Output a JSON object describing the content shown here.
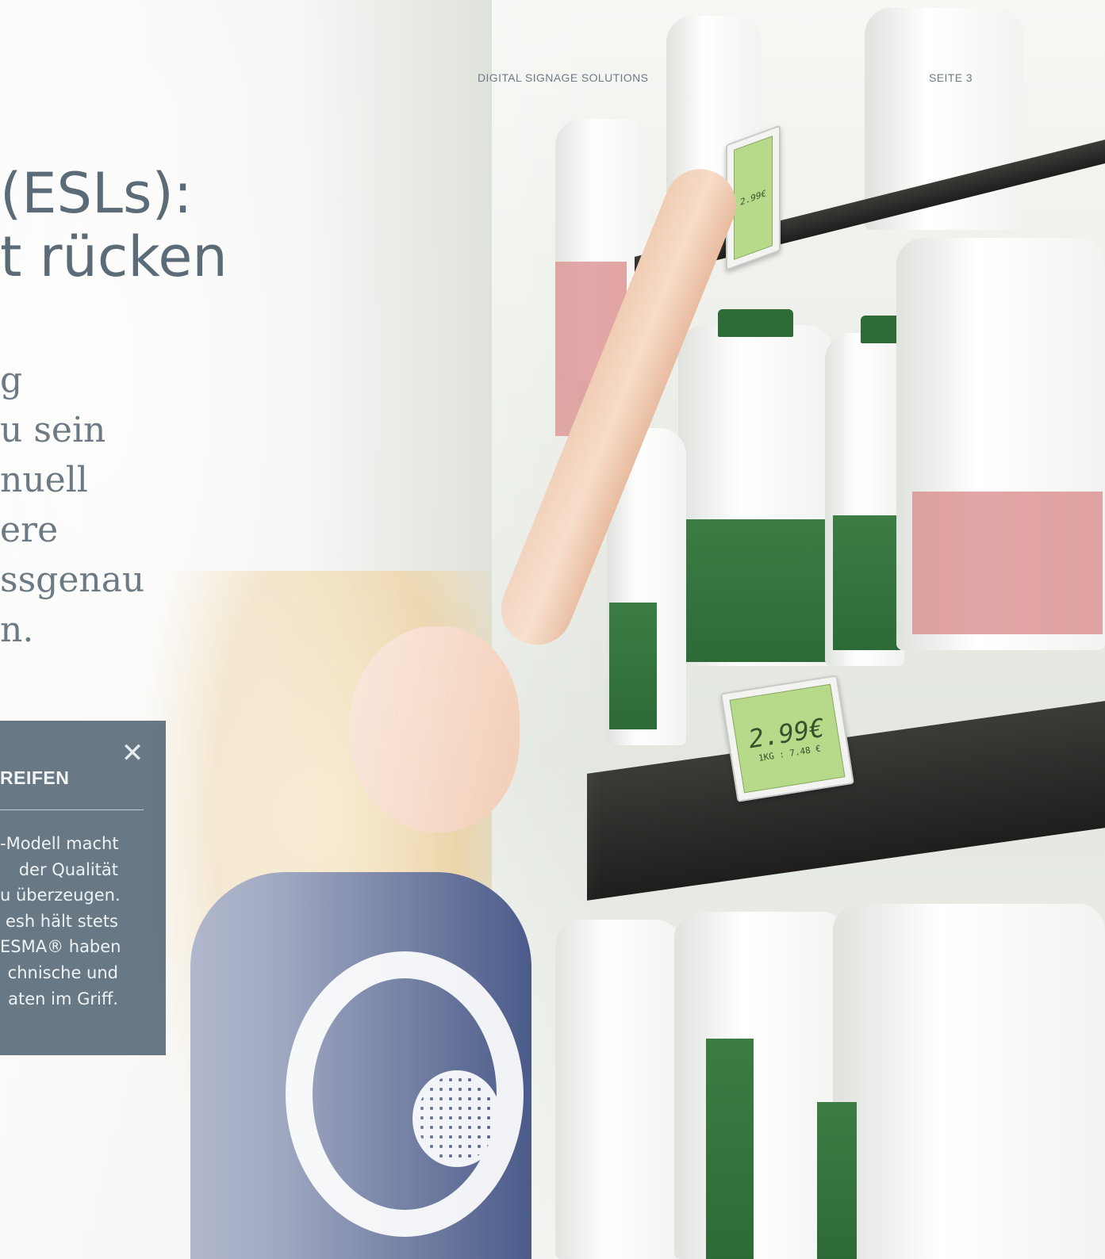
{
  "header": {
    "section_label": "DIGITAL SIGNAGE SOLUTIONS",
    "page_number": "SEITE 3"
  },
  "headline": {
    "lines": [
      "(ESLs):",
      "t rücken"
    ]
  },
  "body": {
    "lines": [
      "g",
      "u sein",
      "nuell",
      "ere",
      "ssgenau",
      "n."
    ]
  },
  "info_box": {
    "title": "REIFEN",
    "close_symbol": "✕",
    "text_lines": [
      "-Modell macht",
      "der Qualität",
      "u überzeugen.",
      "esh hält stets",
      "ESMA® haben",
      "chnische und",
      "aten im Griff."
    ]
  },
  "photo": {
    "shelf_label_price": "2.99€",
    "shelf_label_unit": "1KG : 7.48 €",
    "shelf_label_price_top": "2.99€"
  }
}
